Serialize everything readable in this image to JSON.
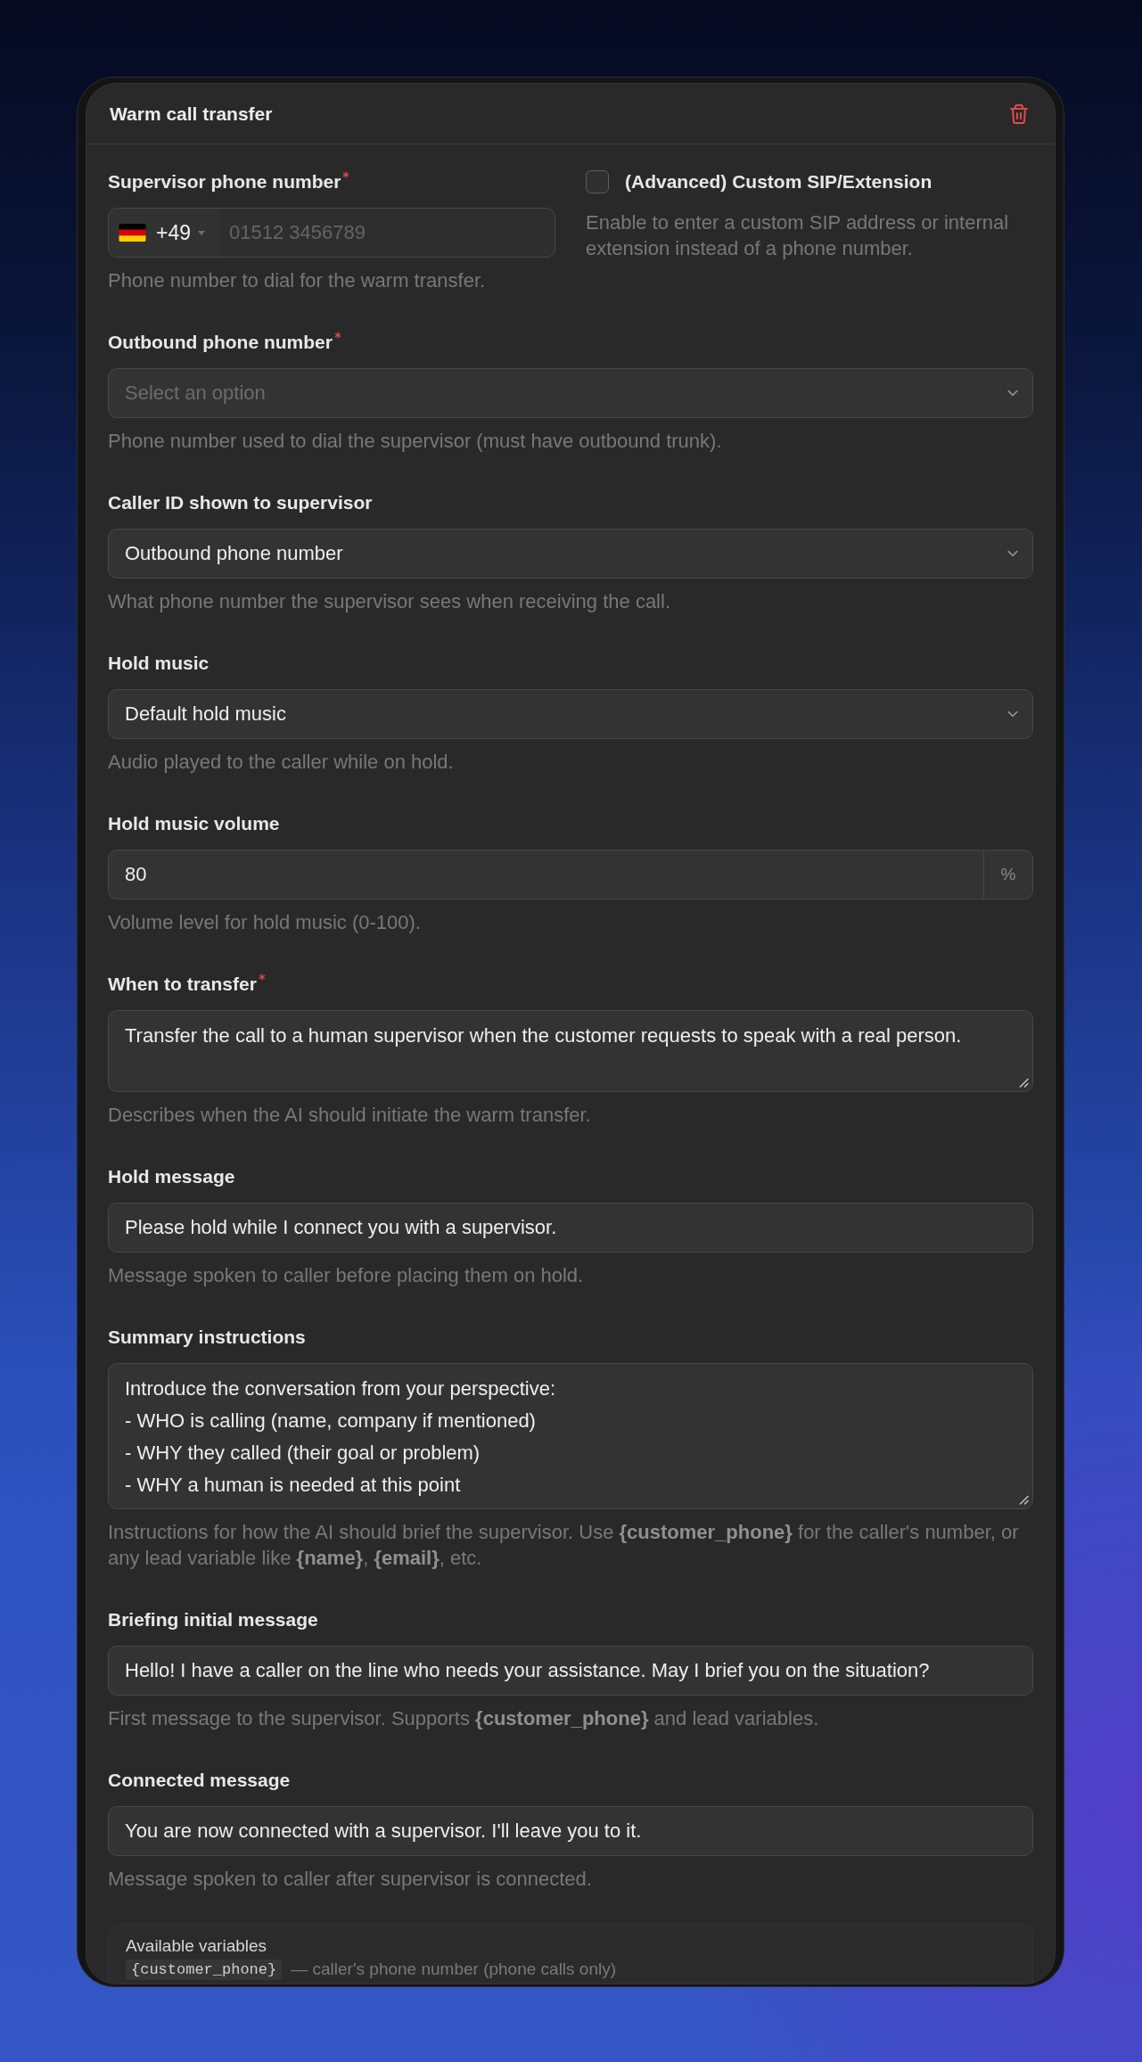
{
  "panel": {
    "title": "Warm call transfer"
  },
  "supervisor_phone": {
    "label": "Supervisor phone number",
    "required": true,
    "country_code": "+49",
    "placeholder": "01512 3456789",
    "hint": "Phone number to dial for the warm transfer."
  },
  "custom_sip": {
    "label": "(Advanced) Custom SIP/Extension",
    "checked": false,
    "hint": "Enable to enter a custom SIP address or internal extension instead of a phone number."
  },
  "fields": [
    {
      "kind": "select",
      "label": "Outbound phone number",
      "required": true,
      "placeholder": "Select an option",
      "hint": "Phone number used to dial the supervisor (must have outbound trunk)."
    },
    {
      "kind": "select",
      "label": "Caller ID shown to supervisor",
      "required": false,
      "value": "Outbound phone number",
      "hint": "What phone number the supervisor sees when receiving the call."
    },
    {
      "kind": "select",
      "label": "Hold music",
      "required": false,
      "value": "Default hold music",
      "hint": "Audio played to the caller while on hold."
    },
    {
      "kind": "number",
      "label": "Hold music volume",
      "required": false,
      "value": "80",
      "suffix": "%",
      "hint": "Volume level for hold music (0-100)."
    },
    {
      "kind": "textarea",
      "label": "When to transfer",
      "required": true,
      "value": "Transfer the call to a human supervisor when the customer requests to speak with a real person.",
      "hint": "Describes when the AI should initiate the warm transfer."
    },
    {
      "kind": "text",
      "label": "Hold message",
      "required": false,
      "value": "Please hold while I connect you with a supervisor.",
      "hint": "Message spoken to caller before placing them on hold."
    },
    {
      "kind": "textarea",
      "label": "Summary instructions",
      "required": false,
      "value": "Introduce the conversation from your perspective:\n- WHO is calling (name, company if mentioned)\n- WHY they called (their goal or problem)\n- WHY a human is needed at this point",
      "hint": "Instructions for how the AI should brief the supervisor. Use **{customer_phone}** for the caller's number, or any lead variable like **{name}**, **{email}**, etc."
    },
    {
      "kind": "text",
      "label": "Briefing initial message",
      "required": false,
      "value": "Hello! I have a caller on the line who needs your assistance. May I brief you on the situation?",
      "hint": "First message to the supervisor. Supports **{customer_phone}** and lead variables."
    },
    {
      "kind": "text",
      "label": "Connected message",
      "required": false,
      "value": "You are now connected with a supervisor. I'll leave you to it.",
      "hint": "Message spoken to caller after supervisor is connected."
    }
  ],
  "available_variables": {
    "title": "Available variables",
    "items": [
      {
        "name": "{customer_phone}",
        "description": "— caller's phone number (phone calls only)"
      }
    ]
  }
}
